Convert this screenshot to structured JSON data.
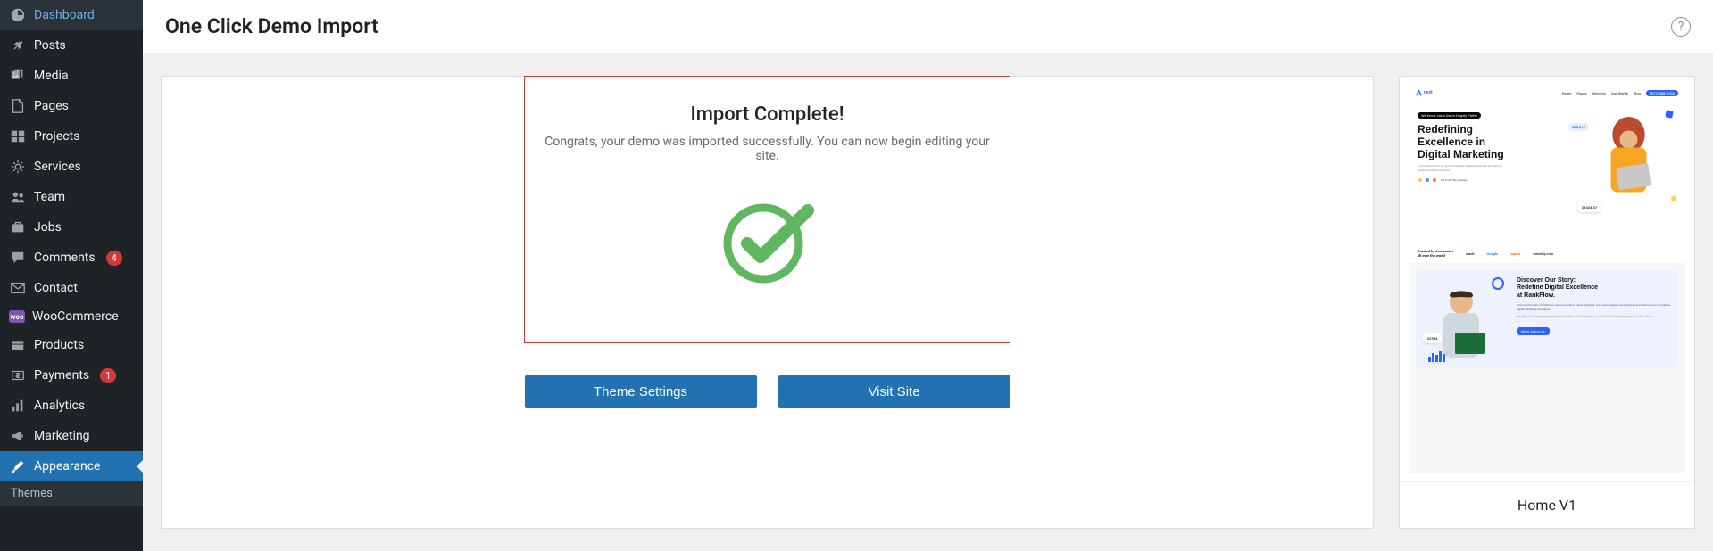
{
  "sidebar": {
    "items": [
      {
        "icon": "dashboard",
        "label": "Dashboard"
      },
      {
        "icon": "pin",
        "label": "Posts"
      },
      {
        "icon": "media",
        "label": "Media"
      },
      {
        "icon": "page",
        "label": "Pages"
      },
      {
        "icon": "portfolio",
        "label": "Projects"
      },
      {
        "icon": "services",
        "label": "Services"
      },
      {
        "icon": "team",
        "label": "Team"
      },
      {
        "icon": "jobs",
        "label": "Jobs"
      },
      {
        "icon": "comments",
        "label": "Comments",
        "badge": "4"
      },
      {
        "icon": "email",
        "label": "Contact"
      },
      {
        "icon": "woo",
        "label": "WooCommerce"
      },
      {
        "icon": "products",
        "label": "Products"
      },
      {
        "icon": "payments",
        "label": "Payments",
        "badge": "1"
      },
      {
        "icon": "analytics",
        "label": "Analytics"
      },
      {
        "icon": "marketing",
        "label": "Marketing"
      },
      {
        "icon": "appearance",
        "label": "Appearance",
        "active": true
      }
    ],
    "subitem": "Themes"
  },
  "header": {
    "title": "One Click Demo Import"
  },
  "import": {
    "title": "Import Complete!",
    "subtitle": "Congrats, your demo was imported successfully. You can now begin editing your site."
  },
  "buttons": {
    "theme_settings": "Theme Settings",
    "visit_site": "Visit Site"
  },
  "preview": {
    "label": "Home V1",
    "logo": "next",
    "nav": [
      "Home",
      "Pages",
      "Services",
      "Our Works",
      "Blog"
    ],
    "phone": "(471) 588-9702",
    "chip": "We Know, Ideal Users Hugely Prefer",
    "headline_l1": "Redefining",
    "headline_l2": "Excellence in",
    "headline_l3": "Digital Marketing",
    "reviews": "4.8 from 10k+ reviews",
    "stat1": "$25,215",
    "stat2": "$1024.57",
    "trust_title": "Trusted by Companies all over the world",
    "trust_logos": [
      "slack",
      "Google",
      "zapier",
      "monday.com"
    ],
    "story_h_l1": "Discover Our Story:",
    "story_h_l2": "Redefine Digital Excellence",
    "story_h_l3": "at RankFlow.",
    "story_btn": "More About Us",
    "story_badge": "$2984"
  }
}
